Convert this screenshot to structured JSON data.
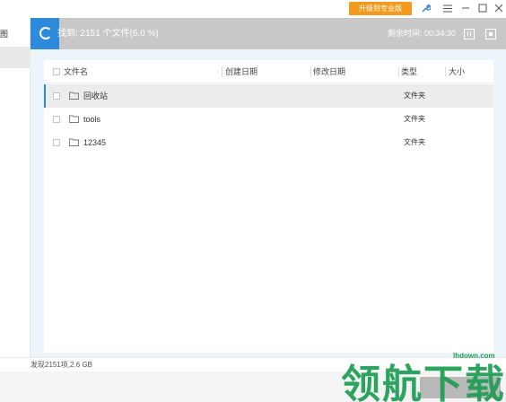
{
  "titlebar": {
    "upgrade_label": "升级到专业版",
    "icons": [
      "wrench-icon",
      "menu-icon",
      "minimize-icon",
      "maximize-icon",
      "close-icon"
    ]
  },
  "sidebar": {
    "items": [
      {
        "label": "图"
      },
      {
        "label": ""
      }
    ]
  },
  "scan": {
    "found_text": "找到: 2151 个文件(6.0 %)",
    "remaining_text": "剩余时间: 00:34:30",
    "accent_color": "#2e8bdc"
  },
  "table": {
    "headers": {
      "name": "文件名",
      "created": "创建日期",
      "modified": "修改日期",
      "type": "类型",
      "size": "大小"
    },
    "rows": [
      {
        "name": "回收站",
        "type": "文件夹",
        "selected": true
      },
      {
        "name": "tools",
        "type": "文件夹",
        "selected": false
      },
      {
        "name": "12345",
        "type": "文件夹",
        "selected": false
      }
    ]
  },
  "status": {
    "text": "发现2151项,2.6 GB"
  },
  "watermark": {
    "big": "领航下载",
    "url": "lhdown.com",
    "color": "#1d9d54"
  }
}
